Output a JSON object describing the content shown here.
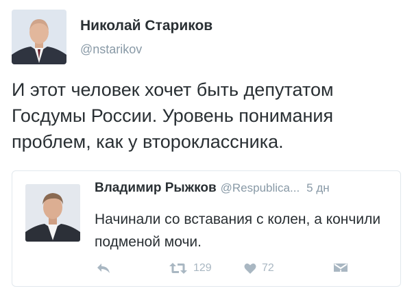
{
  "tweet": {
    "author_name": "Николай Стариков",
    "author_handle": "@nstarikov",
    "text": "И этот человек хочет быть депутатом Госдумы России. Уровень понимания проблем, как у второклассника."
  },
  "quoted_tweet": {
    "author_name": "Владимир Рыжков",
    "author_handle": "@Respublica...",
    "time": "5 дн",
    "text": "Начинали со вставания с колен, а кончили подменой мочи."
  },
  "actions": {
    "reply_icon": "reply-icon",
    "retweet_icon": "retweet-icon",
    "retweet_count": "129",
    "like_icon": "heart-icon",
    "like_count": "72",
    "dm_icon": "direct-message-icon"
  },
  "colors": {
    "text": "#292f33",
    "secondary": "#8899a6",
    "icon": "#a9b7c2",
    "border": "#e1e8ed"
  }
}
